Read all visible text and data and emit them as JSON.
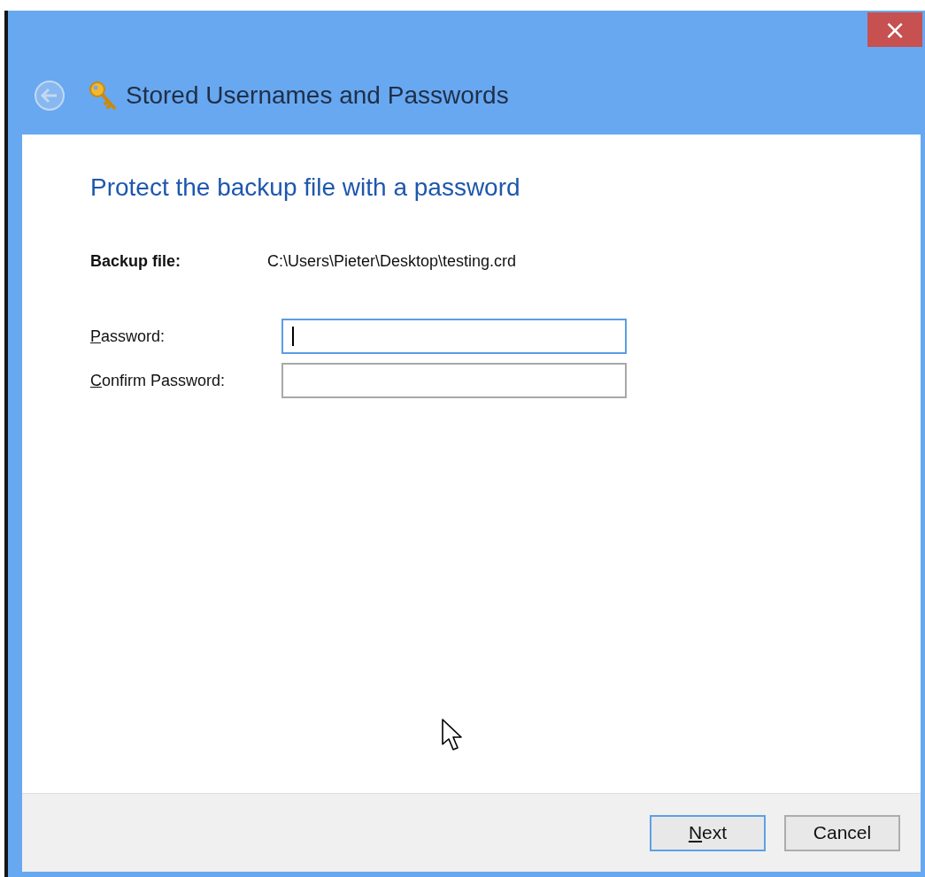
{
  "window": {
    "title": "Stored Usernames and Passwords",
    "close": "×",
    "back_disabled": true
  },
  "heading": "Protect the backup file with a password",
  "backup": {
    "label": "Backup file:",
    "value": "C:\\Users\\Pieter\\Desktop\\testing.crd"
  },
  "fields": [
    {
      "accel": "P",
      "rest": "assword:",
      "focused": true
    },
    {
      "accel": "C",
      "rest": "onfirm Password:",
      "focused": false
    }
  ],
  "buttons": [
    {
      "accel": "N",
      "rest": "ext",
      "default": true
    },
    {
      "rest": "Cancel",
      "default": false
    }
  ]
}
